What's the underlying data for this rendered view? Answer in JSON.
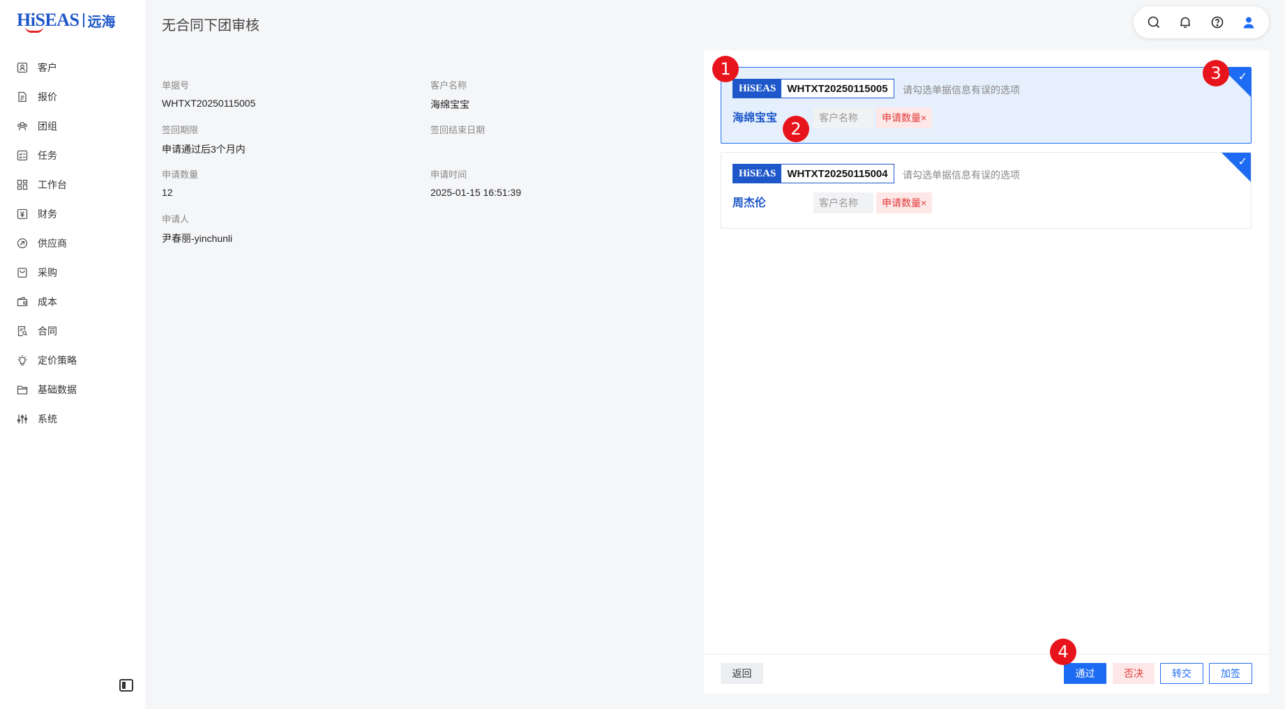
{
  "brand": {
    "logo_text": "HiSEAS",
    "logo_cn": "远海"
  },
  "sidebar": {
    "items": [
      {
        "label": "客户",
        "icon": "customer-icon"
      },
      {
        "label": "报价",
        "icon": "quote-icon"
      },
      {
        "label": "团组",
        "icon": "group-icon"
      },
      {
        "label": "任务",
        "icon": "task-icon"
      },
      {
        "label": "工作台",
        "icon": "workbench-icon"
      },
      {
        "label": "财务",
        "icon": "finance-icon"
      },
      {
        "label": "供应商",
        "icon": "supplier-icon"
      },
      {
        "label": "采购",
        "icon": "purchase-icon"
      },
      {
        "label": "成本",
        "icon": "cost-icon"
      },
      {
        "label": "合同",
        "icon": "contract-icon"
      },
      {
        "label": "定价策略",
        "icon": "pricing-icon"
      },
      {
        "label": "基础数据",
        "icon": "basic-data-icon"
      },
      {
        "label": "系统",
        "icon": "system-icon"
      }
    ]
  },
  "page": {
    "title": "无合同下团审核"
  },
  "info": {
    "doc_no_label": "单据号",
    "doc_no": "WHTXT20250115005",
    "customer_label": "客户名称",
    "customer": "海绵宝宝",
    "return_period_label": "签回期限",
    "return_period": "申请通过后3个月内",
    "return_end_label": "签回结束日期",
    "return_end": "",
    "quantity_label": "申请数量",
    "quantity": "12",
    "apply_time_label": "申请时间",
    "apply_time": "2025-01-15 16:51:39",
    "applicant_label": "申请人",
    "applicant": "尹春丽-yinchunli"
  },
  "cards": [
    {
      "brand": "HiSEAS",
      "doc_no": "WHTXT20250115005",
      "hint": "请勾选单据信息有误的选项",
      "customer": "海绵宝宝",
      "field_customer": "客户名称",
      "field_quantity": "申请数量",
      "selected": true
    },
    {
      "brand": "HiSEAS",
      "doc_no": "WHTXT20250115004",
      "hint": "请勾选单据信息有误的选项",
      "customer": "周杰伦",
      "field_customer": "客户名称",
      "field_quantity": "申请数量",
      "selected": false
    }
  ],
  "chip_close": "×",
  "check_mark": "✓",
  "actions": {
    "back": "返回",
    "pass": "通过",
    "reject": "否决",
    "transfer": "转交",
    "add_sign": "加签"
  },
  "markers": [
    "1",
    "2",
    "3",
    "4"
  ],
  "colors": {
    "primary": "#1d6bf3",
    "brand": "#1d57c9",
    "danger": "#e23a3a",
    "marker": "#e8141b"
  }
}
